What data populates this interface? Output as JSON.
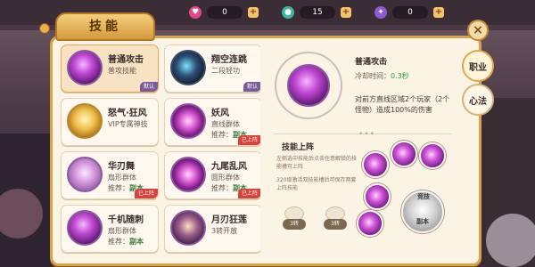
{
  "resources": [
    {
      "icon": "heart-gem-icon",
      "color": "#e0458f",
      "value": "0"
    },
    {
      "icon": "green-orb-icon",
      "color": "#3bb7a0",
      "value": "15"
    },
    {
      "icon": "purple-bat-icon",
      "color": "#8c5ad6",
      "value": "0"
    }
  ],
  "panel": {
    "title": "技能"
  },
  "skills": [
    {
      "name": "普通攻击",
      "desc": "普攻技能",
      "rec": "",
      "tag": "默认",
      "tag_color": "#7a5a9a",
      "orb": "arcane-slash-icon",
      "selected": true
    },
    {
      "name": "翔空连跳",
      "desc": "二段轻功",
      "rec": "",
      "tag": "默认",
      "tag_color": "#7a5a9a",
      "orb": "shadow-mask-icon",
      "selected": false
    },
    {
      "name": "怒气·狂风",
      "desc": "VIP专属神技",
      "rec": "",
      "tag": "",
      "orb": "golden-spirit-icon",
      "selected": false
    },
    {
      "name": "妖风",
      "desc": "直线群体",
      "rec_label": "推荐：",
      "rec": "副本",
      "tag": "已上阵",
      "tag_color": "#d8423a",
      "orb": "vortex-icon",
      "selected": false
    },
    {
      "name": "华刃舞",
      "desc": "扇形群体",
      "rec_label": "推荐：",
      "rec": "副本",
      "tag": "已上阵",
      "tag_color": "#d8423a",
      "orb": "blade-dance-icon",
      "selected": false
    },
    {
      "name": "九尾乱风",
      "desc": "圆形群体",
      "rec_label": "推荐：",
      "rec": "副本",
      "tag": "已上阵",
      "tag_color": "#d8423a",
      "orb": "nine-tails-icon",
      "selected": false
    },
    {
      "name": "千机随刺",
      "desc": "扇形群体",
      "rec_label": "推荐：",
      "rec": "副本",
      "tag": "",
      "orb": "thousand-blades-icon",
      "selected": false
    },
    {
      "name": "月刃狂莲",
      "desc": "3转开放",
      "rec": "",
      "tag": "",
      "orb": "moon-lotus-icon",
      "selected": false
    }
  ],
  "detail": {
    "name": "普通攻击",
    "cd_label": "冷却时间：",
    "cd_value": "0.3秒",
    "text": "对前方直线区域2个玩家（2个怪物）造成100%的伤害",
    "section_title": "技能上阵",
    "hint1": "左侧选中技能后点击任意解锁的技能槽可上阵",
    "hint2": "320级激活双技能槽后可保存两套上阵技能",
    "tokens": [
      "3转",
      "3转"
    ],
    "big_slot_label": "副本",
    "big_slot_top": "竞技"
  },
  "side": {
    "close": "×",
    "career": "职业",
    "heart_skill": "心法"
  }
}
